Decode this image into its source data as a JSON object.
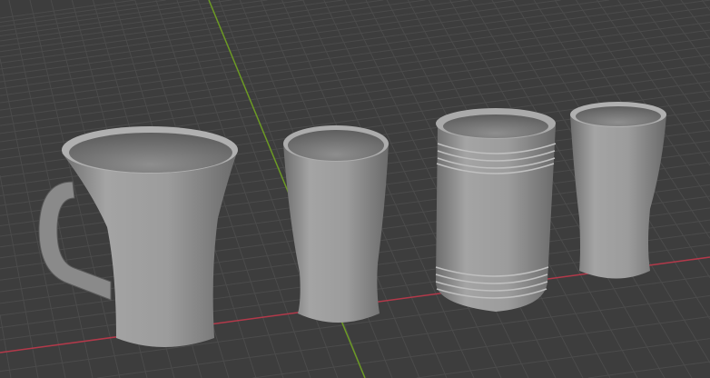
{
  "viewport": {
    "background_color": "#3d3d3d",
    "grid_color": "#4b4b4b",
    "x_axis_color": "#b3394a",
    "y_axis_color": "#6c9a24",
    "object_color": "#9a9a9a"
  },
  "objects": [
    {
      "name": "mug"
    },
    {
      "name": "tall-glass"
    },
    {
      "name": "jar"
    },
    {
      "name": "pint-glass"
    }
  ]
}
